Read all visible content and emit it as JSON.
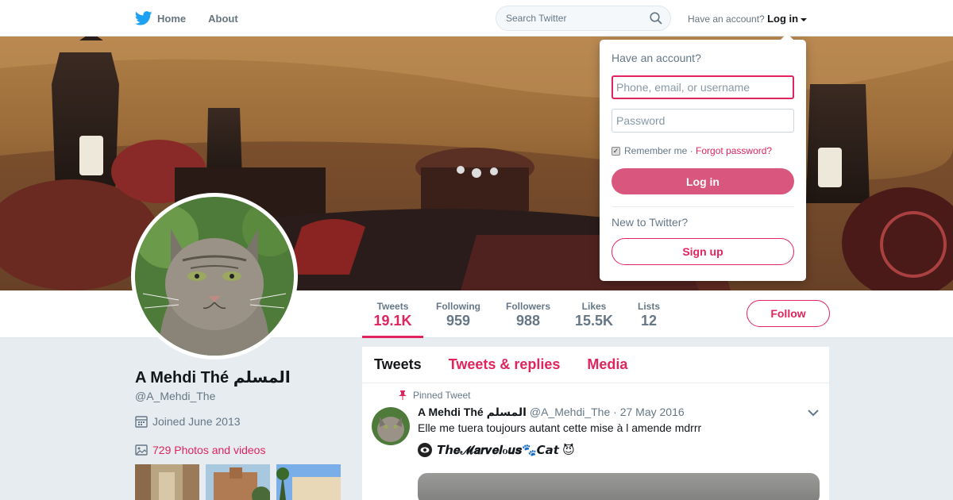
{
  "nav": {
    "home_label": "Home",
    "about_label": "About",
    "search_placeholder": "Search Twitter",
    "have_account": "Have an account?",
    "login_label": "Log in"
  },
  "profile": {
    "name": "A Mehdi Thé المسلم",
    "handle": "@A_Mehdi_The",
    "joined": "Joined June 2013",
    "photos": "729 Photos and videos",
    "follow_label": "Follow",
    "stats": [
      {
        "label": "Tweets",
        "value": "19.1K"
      },
      {
        "label": "Following",
        "value": "959"
      },
      {
        "label": "Followers",
        "value": "988"
      },
      {
        "label": "Likes",
        "value": "15.5K"
      },
      {
        "label": "Lists",
        "value": "12"
      }
    ]
  },
  "timeline": {
    "tabs": [
      "Tweets",
      "Tweets & replies",
      "Media"
    ],
    "pinned_label": "Pinned Tweet",
    "tweet": {
      "name": "A Mehdi Thé المسلم",
      "handle": "@A_Mehdi_The",
      "date": "· 27 May 2016",
      "text": "Elle me tuera toujours autant cette mise à l amende mdrrr",
      "quoted_name": "𝙏𝙝𝒆𝓜𝒂𝒓𝒗𝒆𝒍ℴ𝒖𝒔🐾𝘾𝙖𝙩 😈"
    }
  },
  "login_box": {
    "title": "Have an account?",
    "username_placeholder": "Phone, email, or username",
    "password_placeholder": "Password",
    "remember": "Remember me",
    "separator": "·",
    "forgot": "Forgot password?",
    "login_button": "Log in",
    "new_to": "New to Twitter?",
    "signup_button": "Sign up"
  },
  "colors": {
    "accent": "#e0245e",
    "twitter_blue": "#1da1f2"
  }
}
